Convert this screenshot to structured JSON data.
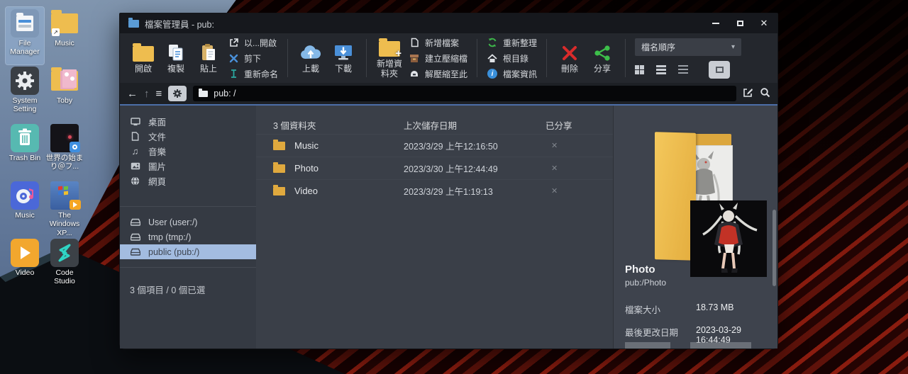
{
  "theme": {
    "accent_line": "#4c6ea8",
    "selection_blue": "#a3bce0",
    "folder_yellow": "#eebd4f",
    "delete_red": "#d92b2b",
    "share_green": "#3dbf4a",
    "upload_blue": "#85b9e8"
  },
  "glyphs": {
    "back": "←",
    "up": "↑",
    "menu": "≡",
    "caret": "▾",
    "close": "✕",
    "music_note": "♫"
  },
  "desktop": {
    "icons": [
      {
        "label": "File Manager"
      },
      {
        "label": "Music"
      },
      {
        "label": "System Setting"
      },
      {
        "label": "Toby"
      },
      {
        "label": "Trash Bin"
      },
      {
        "label": "世界の始まり＠フ..."
      },
      {
        "label": "Music"
      },
      {
        "label": "The Windows XP..."
      },
      {
        "label": "Video"
      },
      {
        "label": "Code Studio"
      }
    ]
  },
  "window": {
    "title": "檔案管理員 - pub:",
    "toolbar": {
      "open": "開啟",
      "copy": "複製",
      "paste": "貼上",
      "open_with": "以...開啟",
      "cut": "剪下",
      "rename": "重新命名",
      "upload": "上載",
      "download": "下載",
      "new_folder": "新增資料夾",
      "new_file": "新增檔案",
      "create_archive": "建立壓縮檔",
      "extract_here": "解壓縮至此",
      "refresh": "重新整理",
      "root": "根目錄",
      "file_info": "檔案資訊",
      "delete": "刪除",
      "share": "分享",
      "sort": "檔名順序"
    },
    "addressbar": {
      "path": "pub: /"
    },
    "sidebar": {
      "places": [
        "桌面",
        "文件",
        "音樂",
        "圖片",
        "網頁"
      ],
      "drives": [
        "User (user:/)",
        "tmp (tmp:/)",
        "public (pub:/)"
      ],
      "status": "3 個項目 / 0 個已選"
    },
    "list": {
      "header": {
        "count": "3 個資料夾",
        "date": "上次儲存日期",
        "shared": "已分享"
      },
      "rows": [
        {
          "name": "Music",
          "date": "2023/3/29 上午12:16:50",
          "shared": "✕"
        },
        {
          "name": "Photo",
          "date": "2023/3/30 上午12:44:49",
          "shared": "✕"
        },
        {
          "name": "Video",
          "date": "2023/3/29 上午1:19:13",
          "shared": "✕"
        }
      ]
    },
    "preview": {
      "title": "Photo",
      "path": "pub:/Photo",
      "details": [
        {
          "label": "檔案大小",
          "value": "18.73 MB"
        },
        {
          "label": "最後更改日期",
          "value": "2023-03-29 16:44:49"
        }
      ]
    }
  }
}
